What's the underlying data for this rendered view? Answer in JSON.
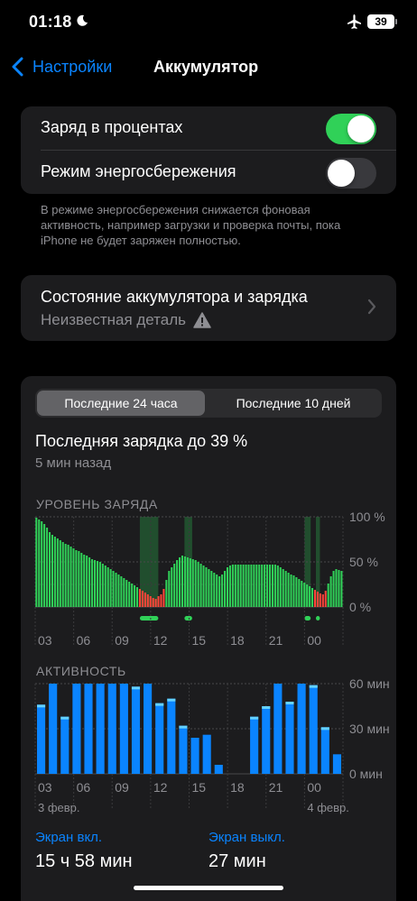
{
  "status": {
    "time": "01:18",
    "battery": "39"
  },
  "nav": {
    "back_label": "Настройки",
    "title": "Аккумулятор"
  },
  "settings": {
    "percent_label": "Заряд в процентах",
    "percent_on": true,
    "low_power_label": "Режим энергосбережения",
    "low_power_on": false,
    "footnote": "В режиме энергосбережения снижается фоновая активность, например загрузки и проверка почты, пока iPhone не будет заряжен полностью."
  },
  "health": {
    "title": "Состояние аккумулятора и зарядка",
    "subtitle": "Неизвестная деталь"
  },
  "usage": {
    "tabs": [
      "Последние 24 часа",
      "Последние 10 дней"
    ],
    "active_tab": 0,
    "last_charge": "Последняя зарядка до 39 %",
    "last_charge_time": "5 мин назад",
    "level_caption": "УРОВЕНЬ ЗАРЯДА",
    "activity_caption": "АКТИВНОСТЬ",
    "screen_on_label": "Экран вкл.",
    "screen_on_value": "15 ч 58 мин",
    "screen_off_label": "Экран выкл.",
    "screen_off_value": "27 мин"
  },
  "colors": {
    "accent": "#0a84ff",
    "green": "#30d158",
    "red": "#ff453a",
    "card": "#1c1c1e"
  },
  "chart_data": [
    {
      "type": "bar",
      "caption": "УРОВЕНЬ ЗАРЯДА",
      "x_tick_labels": [
        "03",
        "06",
        "09",
        "12",
        "15",
        "18",
        "21",
        "00"
      ],
      "y_tick_labels": [
        "100 %",
        "50 %",
        "0 %"
      ],
      "ylim": [
        0,
        100
      ],
      "values": [
        99,
        97,
        95,
        92,
        88,
        83,
        80,
        78,
        76,
        74,
        72,
        70,
        69,
        67,
        65,
        63,
        62,
        60,
        58,
        57,
        55,
        53,
        52,
        51,
        50,
        48,
        46,
        44,
        42,
        40,
        38,
        36,
        34,
        32,
        30,
        28,
        26,
        24,
        22,
        20,
        18,
        16,
        14,
        12,
        10,
        9,
        12,
        14,
        20,
        30,
        40,
        44,
        48,
        52,
        55,
        57,
        56,
        55,
        54,
        53,
        52,
        50,
        48,
        46,
        44,
        42,
        40,
        38,
        36,
        34,
        36,
        40,
        44,
        46,
        47,
        47,
        47,
        47,
        47,
        47,
        47,
        47,
        47,
        47,
        47,
        47,
        47,
        47,
        47,
        47,
        47,
        46,
        44,
        42,
        40,
        38,
        36,
        35,
        33,
        31,
        29,
        27,
        25,
        23,
        21,
        19,
        17,
        15,
        14,
        18,
        26,
        34,
        40,
        42,
        41,
        40
      ],
      "low_threshold": 20,
      "charging_bands": [
        [
          0.34,
          0.4
        ],
        [
          0.485,
          0.51
        ],
        [
          0.875,
          0.895
        ],
        [
          0.912,
          0.925
        ]
      ]
    },
    {
      "type": "bar",
      "caption": "АКТИВНОСТЬ",
      "x_tick_labels": [
        "03",
        "06",
        "09",
        "12",
        "15",
        "18",
        "21",
        "00"
      ],
      "y_tick_labels": [
        "60 мин",
        "30 мин",
        "0 мин"
      ],
      "ylim": [
        0,
        60
      ],
      "values": [
        46,
        60,
        38,
        60,
        60,
        60,
        60,
        60,
        58,
        60,
        47,
        50,
        32,
        24,
        26,
        6,
        0,
        0,
        38,
        45,
        60,
        48,
        60,
        59,
        31,
        13
      ],
      "date_labels": [
        "3 февр.",
        "4 февр."
      ]
    }
  ]
}
